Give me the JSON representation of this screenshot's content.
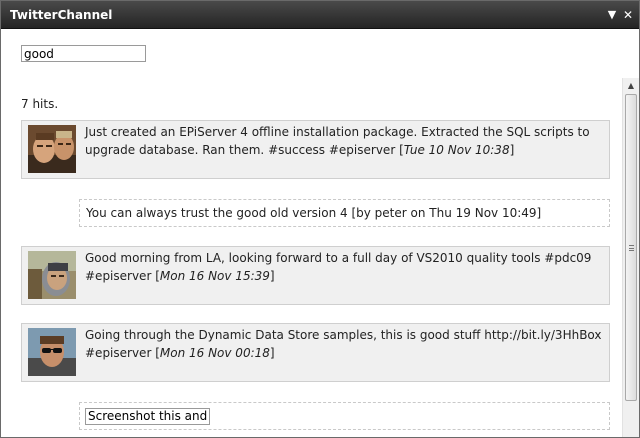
{
  "window": {
    "title": "TwitterChannel"
  },
  "search": {
    "value": "good"
  },
  "results": {
    "hits_label": "7 hits.",
    "items": [
      {
        "text": "Just created an EPiServer 4 offline installation package. Extracted the SQL scripts to upgrade database. Ran them. #success #episerver [",
        "date": "Tue 10 Nov 10:38",
        "close": "]"
      },
      {
        "text": "You can always trust the good old version 4 [by peter on Thu 19 Nov 10:49]"
      },
      {
        "text": "Good morning from LA, looking forward to a full day of VS2010 quality tools #pdc09 #episerver [",
        "date": "Mon 16 Nov 15:39",
        "close": "]"
      },
      {
        "text": "Going through the Dynamic Data Store samples, this is good stuff http://bit.ly/3HhBox #episerver [",
        "date": "Mon 16 Nov 00:18",
        "close": "]"
      }
    ]
  },
  "compose": {
    "value": "Screenshot this and"
  }
}
